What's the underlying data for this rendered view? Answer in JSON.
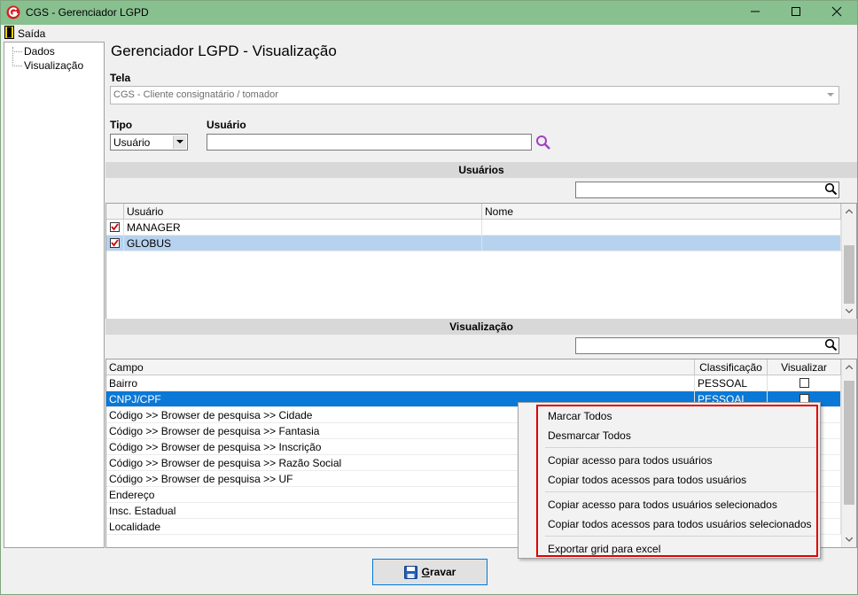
{
  "window": {
    "title": "CGS - Gerenciador LGPD",
    "titlebar_color": "#88c090",
    "controls": [
      "minimize-icon",
      "maximize-icon",
      "close-icon"
    ]
  },
  "menu": {
    "exit_label": "Saída"
  },
  "tree": {
    "items": [
      {
        "label": "Dados"
      },
      {
        "label": "Visualização"
      }
    ]
  },
  "page": {
    "title": "Gerenciador LGPD - Visualização"
  },
  "form": {
    "screen_label": "Tela",
    "screen_value": "CGS - Cliente consignatário / tomador",
    "type_label": "Tipo",
    "type_value": "Usuário",
    "user_label": "Usuário",
    "user_value": ""
  },
  "users_section": {
    "title": "Usuários",
    "search_value": "",
    "columns": [
      "Usuário",
      "Nome"
    ],
    "rows": [
      {
        "checked": true,
        "user": "MANAGER",
        "name": ""
      },
      {
        "checked": true,
        "user": "GLOBUS",
        "name": ""
      }
    ]
  },
  "view_section": {
    "title": "Visualização",
    "search_value": "",
    "columns": [
      "Campo",
      "Classificação",
      "Visualizar"
    ],
    "rows": [
      {
        "field": "Bairro",
        "classification": "PESSOAL",
        "view": false
      },
      {
        "field": "CNPJ/CPF",
        "classification": "PESSOAL",
        "view": false
      },
      {
        "field": "Código >> Browser de pesquisa >> Cidade",
        "classification": "",
        "view": false
      },
      {
        "field": "Código >> Browser de pesquisa >> Fantasia",
        "classification": "",
        "view": false
      },
      {
        "field": "Código >> Browser de pesquisa >> Inscrição",
        "classification": "",
        "view": false
      },
      {
        "field": "Código >> Browser de pesquisa >> Razão Social",
        "classification": "",
        "view": false
      },
      {
        "field": "Código >> Browser de pesquisa >> UF",
        "classification": "",
        "view": false
      },
      {
        "field": "Endereço",
        "classification": "",
        "view": false
      },
      {
        "field": "Insc. Estadual",
        "classification": "",
        "view": false
      },
      {
        "field": "Localidade",
        "classification": "",
        "view": false
      }
    ]
  },
  "context_menu": {
    "items": [
      "Marcar Todos",
      "Desmarcar Todos",
      "Copiar acesso para todos usuários",
      "Copiar todos acessos para todos usuários",
      "Copiar acesso para todos usuários selecionados",
      "Copiar todos acessos para todos usuários selecionados",
      "Exportar grid para excel"
    ],
    "highlight_color": "#e00000"
  },
  "footer": {
    "save_label_rest": "ravar",
    "save_label_first": "G"
  }
}
